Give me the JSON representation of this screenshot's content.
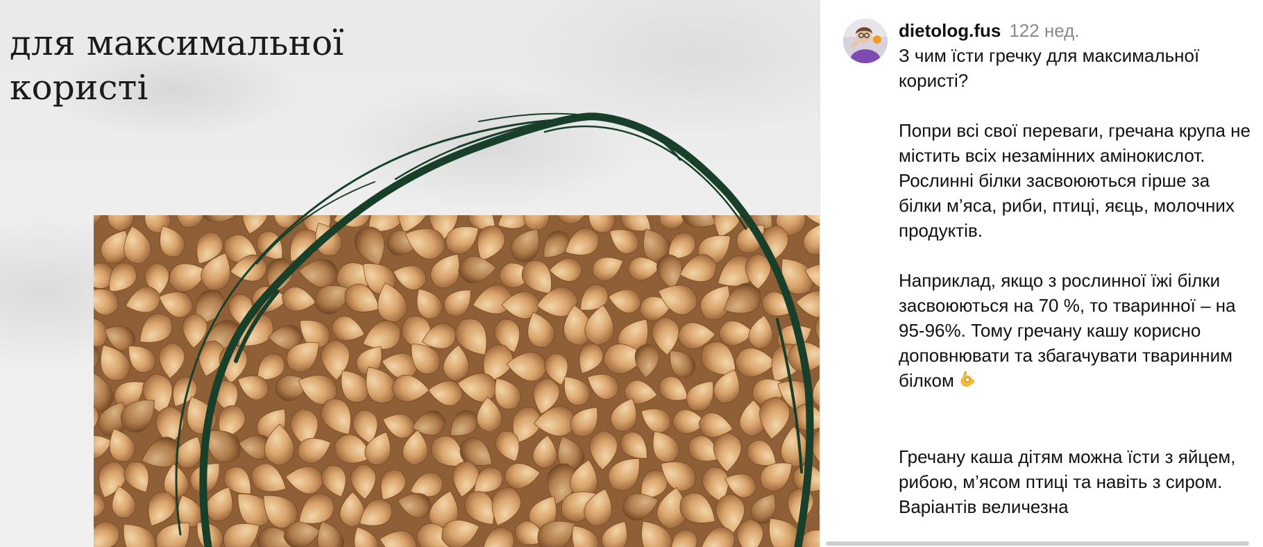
{
  "post": {
    "image": {
      "headline_lines": [
        "для максимальної",
        "користі"
      ],
      "alt": "Гречана крупа"
    },
    "author": {
      "username": "dietolog.fus",
      "time_ago": "122 нед."
    },
    "caption": {
      "paragraphs": [
        "З чим їсти гречку для максимальної користі?",
        "Попри всі свої переваги, гречана крупа не містить всіх незамінних амінокислот. Рослинні білки засвоюються гірше за білки м’яса, риби, птиці, яєць, молочних продуктів.",
        "Наприклад, якщо з рослинної їжі білки засвоюються на 70 %, то тваринної – на 95-96%. Тому гречану кашу корисно доповнювати та збагачувати тваринним білком",
        "Гречану каша дітям можна їсти з яйцем, рибою, м’ясом птиці та навіть з сиром. Варіантів величезна"
      ],
      "emoji": "ok-hand-emoji"
    }
  },
  "colors": {
    "swirl": "#173f2a",
    "grain_base": "#c9955f",
    "grain_highlight": "#edc99a",
    "grain_shadow": "#8a5a33",
    "muted_text": "#8a8a8a"
  }
}
